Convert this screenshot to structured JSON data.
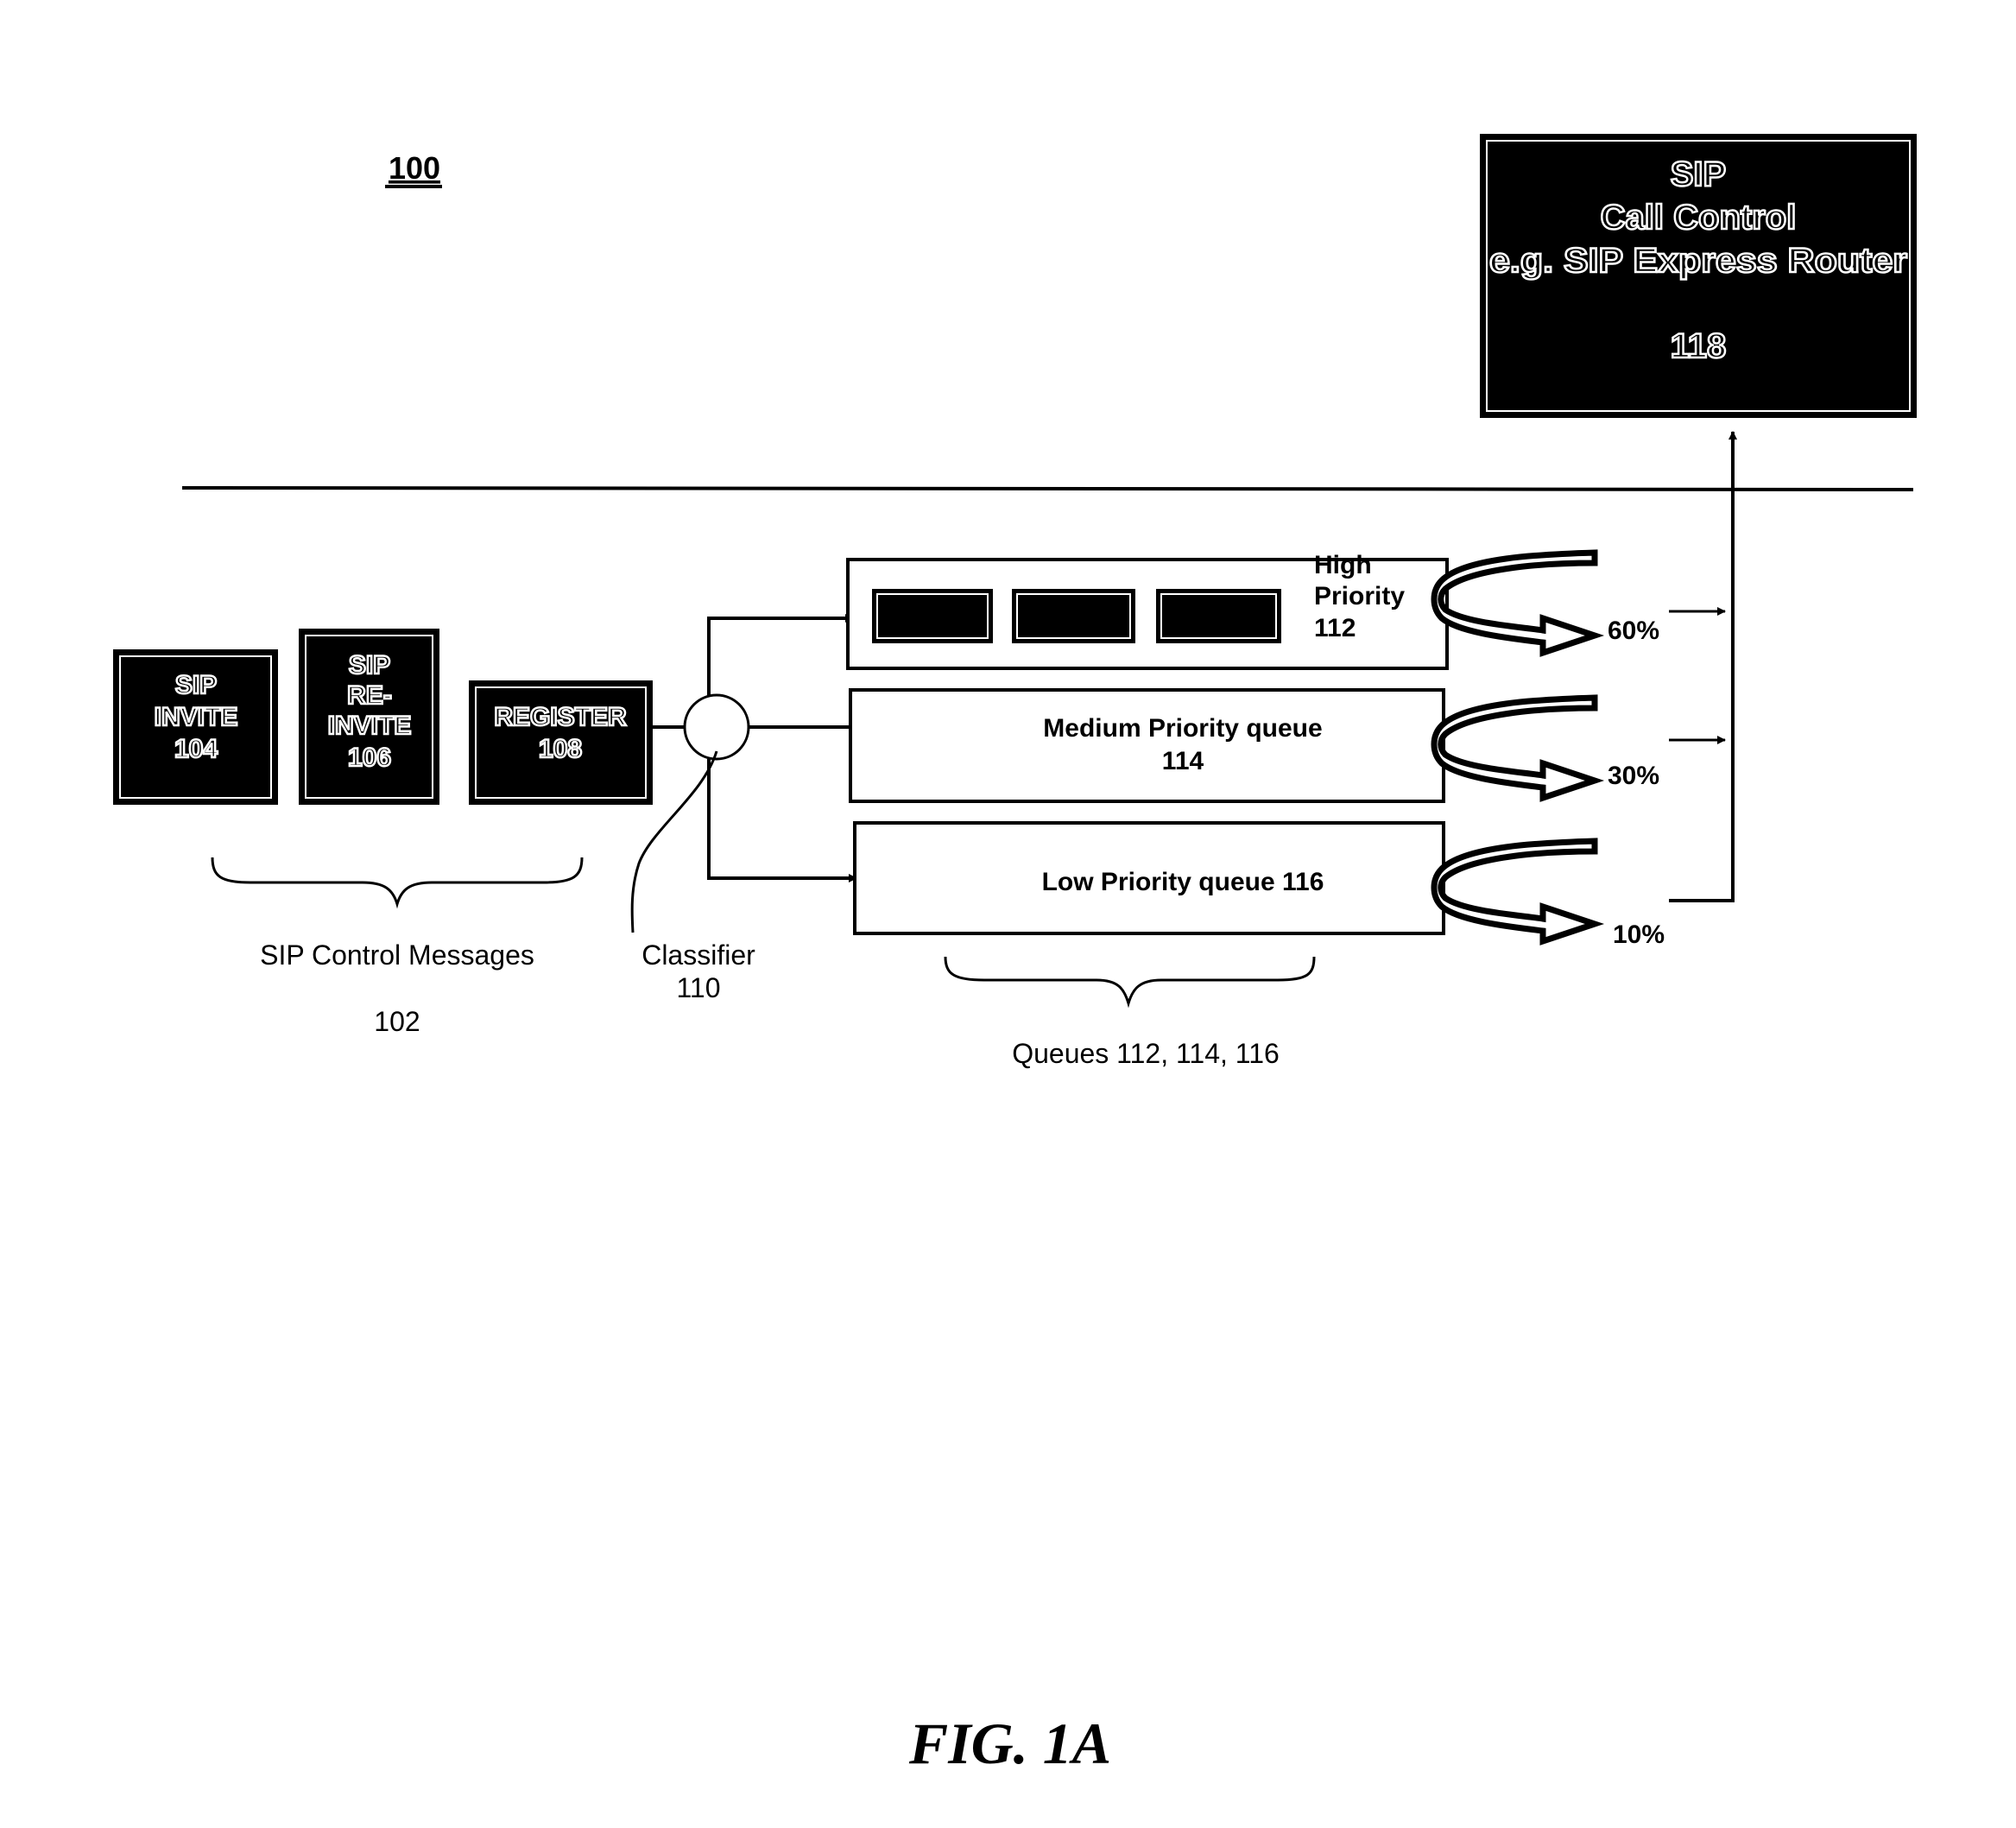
{
  "figure": {
    "reference": "100",
    "caption": "FIG. 1A"
  },
  "call_control": {
    "lines": [
      "SIP",
      "Call Control",
      "e.g. SIP Express Router"
    ],
    "number": "118"
  },
  "messages": [
    {
      "lines": [
        "SIP",
        "INVITE",
        "104"
      ]
    },
    {
      "lines": [
        "SIP",
        "RE-",
        "INVITE",
        "106"
      ]
    },
    {
      "lines": [
        "REGISTER",
        "108"
      ]
    }
  ],
  "messages_label": {
    "title": "SIP Control Messages",
    "number": "102"
  },
  "classifier_label": {
    "title": "Classifier",
    "number": "110"
  },
  "queues": [
    {
      "lines": [
        "High",
        "Priority",
        "112"
      ],
      "share": "60%"
    },
    {
      "lines": [
        "Medium Priority queue",
        "114"
      ],
      "share": "30%"
    },
    {
      "lines": [
        "Low Priority queue 116"
      ],
      "share": "10%"
    }
  ],
  "queues_label": "Queues 112, 114, 116",
  "colors": {
    "ink": "#000000",
    "paper": "#ffffff"
  }
}
